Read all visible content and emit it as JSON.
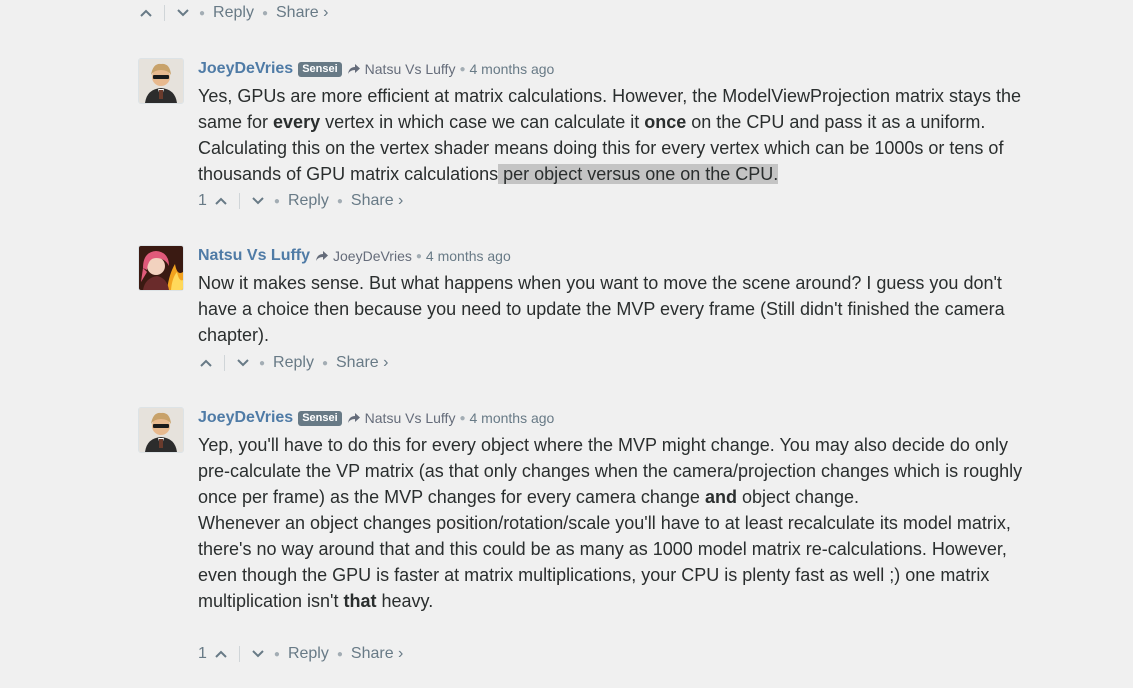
{
  "top_actions": {
    "reply": "Reply",
    "share": "Share ›"
  },
  "comments": [
    {
      "author": "JoeyDeVries",
      "badge": "Sensei",
      "reply_to": "Natsu Vs Luffy",
      "time": "4 months ago",
      "body": {
        "t1": "Yes, GPUs are more efficient at matrix calculations. However, the ModelViewProjection matrix stays the same for ",
        "b1": "every",
        "t2": " vertex in which case we can calculate it ",
        "b2": "once",
        "t3": " on the CPU and pass it as a uniform. Calculating this on the vertex shader means doing this for every vertex which can be 1000s or tens of thousands of GPU matrix calculations",
        "highlight": " per object versus one on the CPU."
      },
      "votes": "1",
      "reply": "Reply",
      "share": "Share ›"
    },
    {
      "author": "Natsu Vs Luffy",
      "reply_to": "JoeyDeVries",
      "time": "4 months ago",
      "body": {
        "t1": "Now it makes sense. But what happens when you want to move the scene around? I guess you don't have a choice then because you need to update the MVP every frame (Still didn't finished the camera chapter)."
      },
      "reply": "Reply",
      "share": "Share ›"
    },
    {
      "author": "JoeyDeVries",
      "badge": "Sensei",
      "reply_to": "Natsu Vs Luffy",
      "time": "4 months ago",
      "body": {
        "t1": "Yep, you'll have to do this for every object where the MVP might change. You may also decide do only pre-calculate the VP matrix (as that only changes when the camera/projection changes which is roughly once per frame) as the MVP changes for every camera change ",
        "b1": "and",
        "t2": " object change.",
        "p2": "Whenever an object changes position/rotation/scale you'll have to at least recalculate its model matrix, there's no way around that and this could be as many as 1000 model matrix re-calculations. However, even though the GPU is faster at matrix multiplications, your CPU is plenty fast as well ;) one matrix multiplication isn't ",
        "b2": "that",
        "t3": " heavy."
      },
      "votes": "1",
      "reply": "Reply",
      "share": "Share ›"
    }
  ],
  "icons": {
    "upvote": "chevron-up-icon",
    "downvote": "chevron-down-icon",
    "reply_arrow": "share-arrow-icon"
  },
  "colors": {
    "background": "#f0f0f0",
    "author": "#4f7ba6",
    "muted": "#687a86",
    "badge": "#687a86",
    "highlight": "#c4c4c4"
  }
}
